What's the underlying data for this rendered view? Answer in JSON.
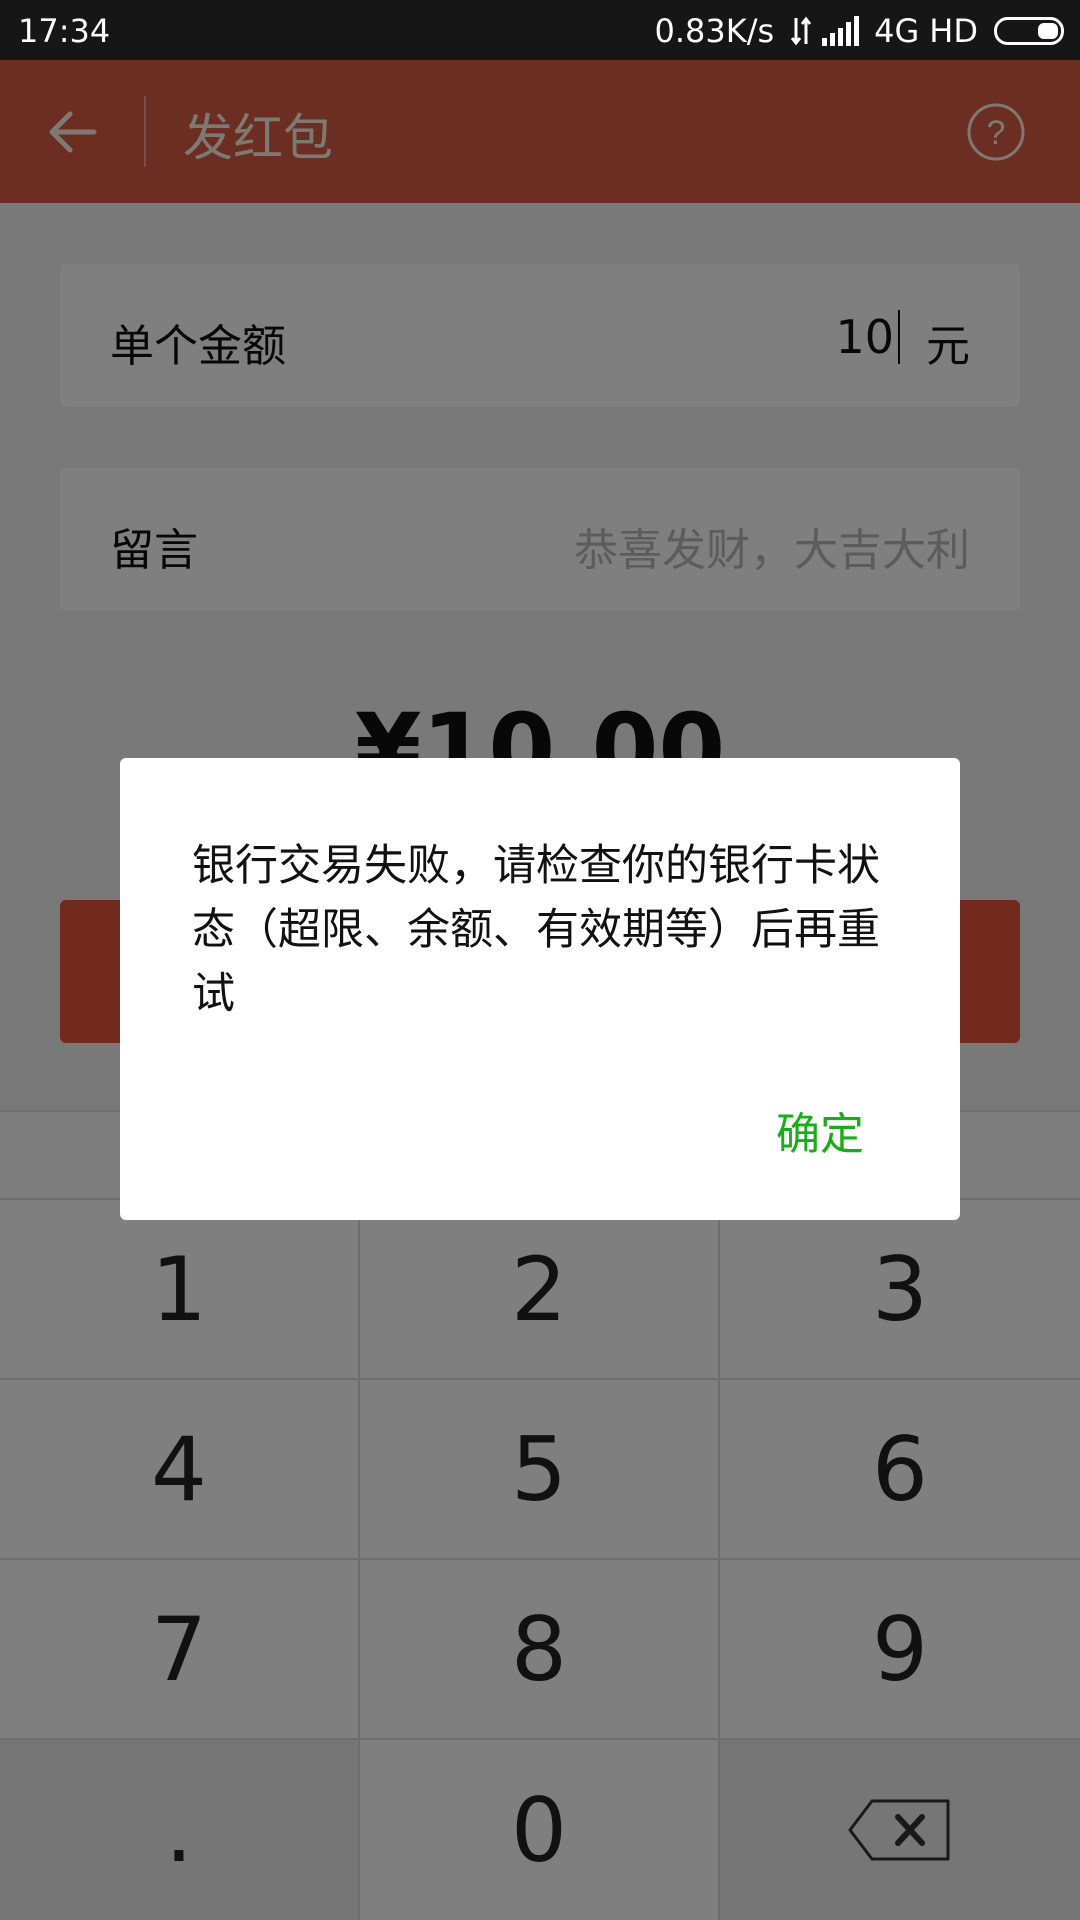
{
  "status_bar": {
    "time": "17:34",
    "speed": "0.83K/s",
    "network": "4G",
    "hd": "HD",
    "icons": [
      "data-arrows-icon",
      "signal-icon",
      "battery-icon"
    ]
  },
  "nav": {
    "title": "发红包",
    "back_icon": "back-arrow-icon",
    "help_icon": "question-circle-icon",
    "bg_color": "#d95c45"
  },
  "form": {
    "amount_label": "单个金额",
    "amount_value": "10",
    "amount_unit": "元",
    "message_label": "留言",
    "message_placeholder": "恭喜发财，大吉大利",
    "total": "¥10.00",
    "submit_color": "#e3553b"
  },
  "keypad": {
    "keys": [
      "1",
      "2",
      "3",
      "4",
      "5",
      "6",
      "7",
      "8",
      "9",
      ".",
      "0"
    ],
    "delete_icon": "backspace-icon"
  },
  "dialog": {
    "message": "银行交易失败，请检查你的银行卡状态（超限、余额、有效期等）后再重试",
    "confirm_label": "确定",
    "confirm_color": "#1aad19"
  }
}
